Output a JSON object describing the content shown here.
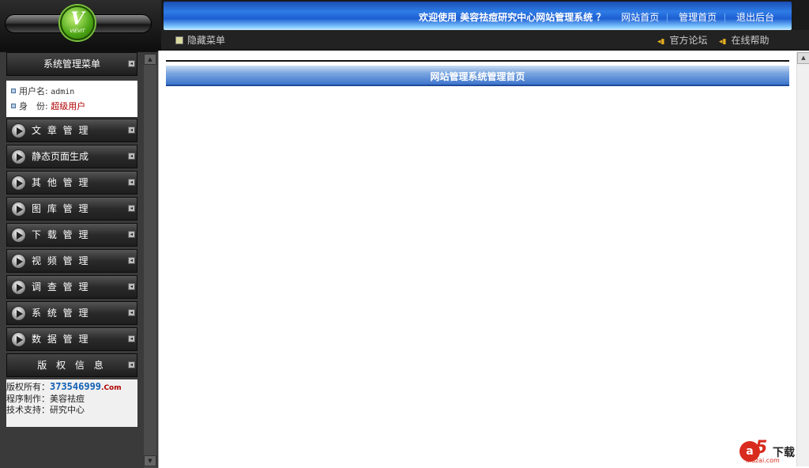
{
  "logo": {
    "letter": "V",
    "word": "VIEVIT"
  },
  "header": {
    "welcome": "欢迎使用 美容祛痘研究中心网站管理系统 ？",
    "links": [
      "网站首页",
      "管理首页",
      "退出后台"
    ]
  },
  "subbar": {
    "hide_menu": "隐藏菜单",
    "forum": "官方论坛",
    "help": "在线帮助"
  },
  "sidebar": {
    "menu_title": "系统管理菜单",
    "user_label": "用户名:",
    "user_value": "admin",
    "role_label": "身　份:",
    "role_value": "超级用户",
    "items": [
      {
        "label": "文 章 管 理"
      },
      {
        "label": "静态页面生成"
      },
      {
        "label": "其 他 管 理"
      },
      {
        "label": "图 库 管 理"
      },
      {
        "label": "下 载 管 理"
      },
      {
        "label": "视 频 管 理"
      },
      {
        "label": "调 查 管 理"
      },
      {
        "label": "系 统 管 理"
      },
      {
        "label": "数 据 管 理"
      }
    ],
    "copyright_title": "版 权 信 息",
    "copyright_owner_label": "版权所有：",
    "copyright_owner_num": "373546999",
    "copyright_owner_suffix": ".Com",
    "producer": "程序制作：美容祛痘",
    "support": "技术支持：研究中心"
  },
  "main": {
    "title": "网站管理系统管理首页"
  },
  "watermark": {
    "logo_letter": "a",
    "logo_digit": "5",
    "text": "下载",
    "url": "xiazai.com"
  }
}
